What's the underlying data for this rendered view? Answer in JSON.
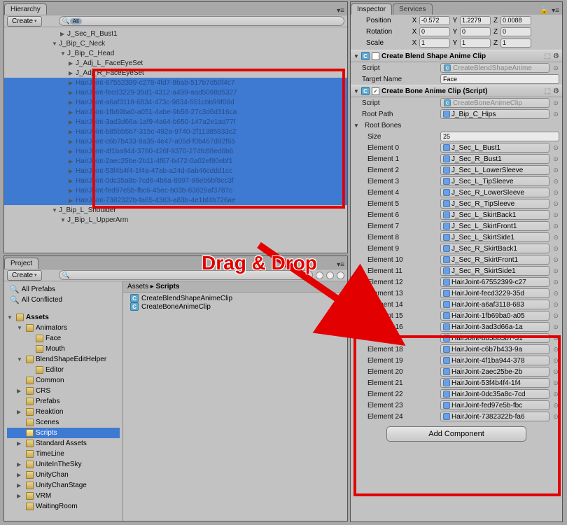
{
  "hierarchy_panel": {
    "tab": "Hierarchy",
    "create_btn": "Create",
    "search_filter": "All",
    "tree": [
      {
        "indent": 80,
        "label": "J_Sec_R_Bust1",
        "plain": true,
        "arrow": "▶"
      },
      {
        "indent": 68,
        "label": "J_Bip_C_Neck",
        "plain": true,
        "arrow": "▼"
      },
      {
        "indent": 80,
        "label": "J_Bip_C_Head",
        "plain": true,
        "arrow": "▼"
      },
      {
        "indent": 92,
        "label": "J_Adj_L_FaceEyeSet",
        "plain": true,
        "arrow": "▶"
      },
      {
        "indent": 92,
        "label": "J_Adj_R_FaceEyeSet",
        "plain": true,
        "arrow": "▶"
      },
      {
        "indent": 92,
        "label": "HairJoint-67552399-c278-4fd7-8bab-517b7d50f4c7",
        "sel": true,
        "arrow": "▶"
      },
      {
        "indent": 92,
        "label": "HairJoint-fecd3229-35d1-4312-a499-aad5098d5327",
        "sel": true,
        "arrow": "▶"
      },
      {
        "indent": 92,
        "label": "HairJoint-a6af3118-6834-473c-9834-551cbb99f08d",
        "sel": true,
        "arrow": "▶"
      },
      {
        "indent": 92,
        "label": "HairJoint-1fb69ba0-a051-4abe-9b56-27c3d6d316ca",
        "sel": true,
        "arrow": "▶"
      },
      {
        "indent": 92,
        "label": "HairJoint-3ad3d66a-1af9-4a64-b650-147a2e1ad77f",
        "sel": true,
        "arrow": "▶"
      },
      {
        "indent": 92,
        "label": "HairJoint-b85bb5b7-315c-492a-9740-2f11385833c2",
        "sel": true,
        "arrow": "▶"
      },
      {
        "indent": 92,
        "label": "HairJoint-c6b7b433-9a35-4e47-a05d-f0b467d92f65",
        "sel": true,
        "arrow": "▶"
      },
      {
        "indent": 92,
        "label": "HairJoint-4f1ba944-3780-426f-9370-274fc88ed6b6",
        "sel": true,
        "arrow": "▶"
      },
      {
        "indent": 92,
        "label": "HairJoint-2aec25be-2b11-4f67-b472-0a02ef80ebf1",
        "sel": true,
        "arrow": "▶"
      },
      {
        "indent": 92,
        "label": "HairJoint-53f4b4f4-1f4a-47ab-a24d-6ab46cddd1cc",
        "sel": true,
        "arrow": "▶"
      },
      {
        "indent": 92,
        "label": "HairJoint-0dc35a8c-7cd6-4b6a-8997-86eb6bf8cc3f",
        "sel": true,
        "arrow": "▶"
      },
      {
        "indent": 92,
        "label": "HairJoint-fed97e5b-fbc6-45ec-b03b-83829af3787c",
        "sel": true,
        "arrow": "▶"
      },
      {
        "indent": 92,
        "label": "HairJoint-7382322b-fa65-4363-a83b-4e1bf4b726ae",
        "sel": true,
        "arrow": "▶"
      },
      {
        "indent": 68,
        "label": "J_Bip_L_Shoulder",
        "plain": true,
        "arrow": "▼"
      },
      {
        "indent": 80,
        "label": "J_Bip_L_UpperArm",
        "plain": true,
        "arrow": "▼"
      }
    ]
  },
  "project_panel": {
    "tab": "Project",
    "create_btn": "Create",
    "search_results": [
      {
        "label": "All Conflicted",
        "color": "#e8a030"
      }
    ],
    "prefab_label": "All Prefabs",
    "assets_header": "Assets",
    "folders": [
      {
        "label": "Animators",
        "arrow": "▼",
        "indent": 14
      },
      {
        "label": "Face",
        "arrow": "",
        "indent": 28
      },
      {
        "label": "Mouth",
        "arrow": "",
        "indent": 28
      },
      {
        "label": "BlendShapeEditHelper",
        "arrow": "▼",
        "indent": 14
      },
      {
        "label": "Editor",
        "arrow": "",
        "indent": 28
      },
      {
        "label": "Common",
        "arrow": "",
        "indent": 14
      },
      {
        "label": "CRS",
        "arrow": "▶",
        "indent": 14
      },
      {
        "label": "Prefabs",
        "arrow": "",
        "indent": 14
      },
      {
        "label": "Reaktion",
        "arrow": "▶",
        "indent": 14
      },
      {
        "label": "Scenes",
        "arrow": "",
        "indent": 14
      },
      {
        "label": "Scripts",
        "arrow": "",
        "indent": 14,
        "sel": true
      },
      {
        "label": "Standard Assets",
        "arrow": "▶",
        "indent": 14
      },
      {
        "label": "TimeLine",
        "arrow": "",
        "indent": 14
      },
      {
        "label": "UniteInTheSky",
        "arrow": "▶",
        "indent": 14
      },
      {
        "label": "UnityChan",
        "arrow": "▶",
        "indent": 14
      },
      {
        "label": "UnityChanStage",
        "arrow": "▶",
        "indent": 14
      },
      {
        "label": "VRM",
        "arrow": "▶",
        "indent": 14
      },
      {
        "label": "WaitingRoom",
        "arrow": "",
        "indent": 14
      }
    ],
    "breadcrumb_a": "Assets",
    "breadcrumb_b": "Scripts",
    "files": [
      "CreateBlendShapeAnimeClip",
      "CreateBoneAnimeClip"
    ]
  },
  "inspector_panel": {
    "tab_a": "Inspector",
    "tab_b": "Services",
    "transform": {
      "pos": {
        "label": "Position",
        "x": "-0.572",
        "y": "1.2279",
        "z": "0.0088"
      },
      "rot": {
        "label": "Rotation",
        "x": "0",
        "y": "0",
        "z": "0"
      },
      "scl": {
        "label": "Scale",
        "x": "1",
        "y": "1",
        "z": "1"
      }
    },
    "comp1": {
      "title": "Create Blend Shape Anime Clip",
      "checked": false,
      "script_label": "Script",
      "script_val": "CreateBlendShapeAnime",
      "target_label": "Target Name",
      "target_val": "Face"
    },
    "comp2": {
      "title": "Create Bone Anime Clip (Script)",
      "checked": true,
      "script_label": "Script",
      "script_val": "CreateBoneAnimeClip",
      "root_label": "Root Path",
      "root_val": "J_Bip_C_Hips",
      "rootbones_label": "Root Bones",
      "size_label": "Size",
      "size_val": "25",
      "elements": [
        {
          "label": "Element 0",
          "val": "J_Sec_L_Bust1"
        },
        {
          "label": "Element 1",
          "val": "J_Sec_R_Bust1"
        },
        {
          "label": "Element 2",
          "val": "J_Sec_L_LowerSleeve"
        },
        {
          "label": "Element 3",
          "val": "J_Sec_L_TipSleeve"
        },
        {
          "label": "Element 4",
          "val": "J_Sec_R_LowerSleeve"
        },
        {
          "label": "Element 5",
          "val": "J_Sec_R_TipSleeve"
        },
        {
          "label": "Element 6",
          "val": "J_Sec_L_SkirtBack1"
        },
        {
          "label": "Element 7",
          "val": "J_Sec_L_SkirtFront1"
        },
        {
          "label": "Element 8",
          "val": "J_Sec_L_SkirtSide1"
        },
        {
          "label": "Element 9",
          "val": "J_Sec_R_SkirtBack1"
        },
        {
          "label": "Element 10",
          "val": "J_Sec_R_SkirtFront1"
        },
        {
          "label": "Element 11",
          "val": "J_Sec_R_SkirtSide1"
        },
        {
          "label": "Element 12",
          "val": "HairJoint-67552399-c27"
        },
        {
          "label": "Element 13",
          "val": "HairJoint-fecd3229-35d"
        },
        {
          "label": "Element 14",
          "val": "HairJoint-a6af3118-683"
        },
        {
          "label": "Element 15",
          "val": "HairJoint-1fb69ba0-a05"
        },
        {
          "label": "Element 16",
          "val": "HairJoint-3ad3d66a-1a"
        },
        {
          "label": "Element 17",
          "val": "HairJoint-b85bb5b7-31"
        },
        {
          "label": "Element 18",
          "val": "HairJoint-c6b7b433-9a"
        },
        {
          "label": "Element 19",
          "val": "HairJoint-4f1ba944-378"
        },
        {
          "label": "Element 20",
          "val": "HairJoint-2aec25be-2b"
        },
        {
          "label": "Element 21",
          "val": "HairJoint-53f4b4f4-1f4"
        },
        {
          "label": "Element 22",
          "val": "HairJoint-0dc35a8c-7cd"
        },
        {
          "label": "Element 23",
          "val": "HairJoint-fed97e5b-fbc"
        },
        {
          "label": "Element 24",
          "val": "HairJoint-7382322b-fa6"
        }
      ]
    },
    "add_component": "Add Component"
  },
  "annotation": "Drag & Drop"
}
